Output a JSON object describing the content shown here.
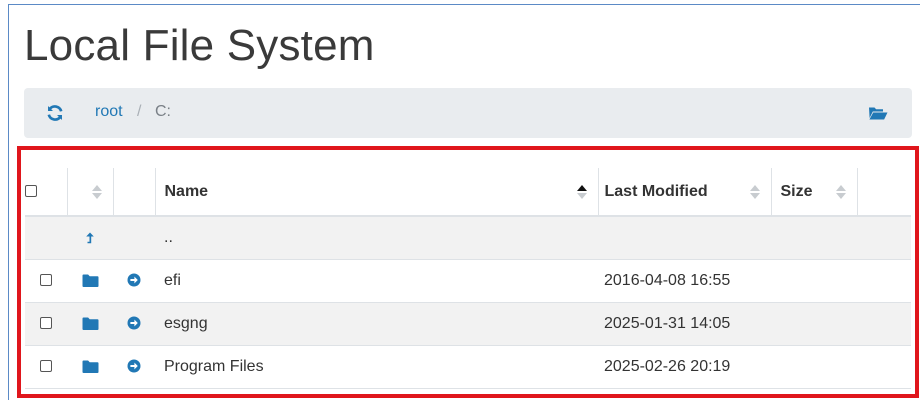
{
  "page": {
    "title": "Local File System"
  },
  "breadcrumb": {
    "refresh_icon": "refresh-icon",
    "root_label": "root",
    "separator": "/",
    "current": "C:",
    "open_folder_icon": "folder-open-icon"
  },
  "table": {
    "columns": {
      "select": "",
      "type": "",
      "action": "",
      "name": "Name",
      "last_modified": "Last Modified",
      "size": "Size"
    },
    "sorted_by": "Name",
    "up_row": {
      "icon": "level-up-icon",
      "name": ".."
    },
    "rows": [
      {
        "name": "efi",
        "last_modified": "2016-04-08 16:55",
        "size": "",
        "icon": "folder-icon",
        "action_icon": "arrow-circle-right-icon"
      },
      {
        "name": "esgng",
        "last_modified": "2025-01-31 14:05",
        "size": "",
        "icon": "folder-icon",
        "action_icon": "arrow-circle-right-icon"
      },
      {
        "name": "Program Files",
        "last_modified": "2025-02-26 20:19",
        "size": "",
        "icon": "folder-icon",
        "action_icon": "arrow-circle-right-icon"
      }
    ]
  },
  "colors": {
    "accent": "#2178b5",
    "highlight_border": "#e0161c",
    "breadcrumb_bg": "#e9ecef"
  }
}
